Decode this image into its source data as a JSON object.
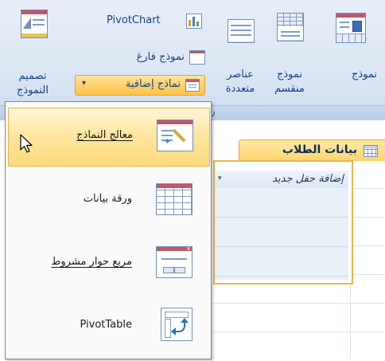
{
  "ribbon": {
    "pivotchart_label": "PivotChart",
    "blank_form_label": "نموذج فارغ",
    "more_forms_label": "نماذج إضافية",
    "more_forms_arrow": "▾",
    "form_design_label_1": "تصميم",
    "form_design_label_2": "النموذج",
    "multiple_items_label_1": "عناصر",
    "multiple_items_label_2": "متعددة",
    "split_form_label_1": "نموذج",
    "split_form_label_2": "منقسم",
    "form_label": "نموذج",
    "group_fragment": "ن"
  },
  "document": {
    "tab_title": "بيانات الطلاب",
    "add_field_header": "إضافة حقل جديد",
    "header_dropdown": "▾"
  },
  "menu": {
    "items": [
      {
        "label": "معالج النماذج",
        "icon": "form-wizard-icon",
        "state": "hover"
      },
      {
        "label": "ورقة بيانات",
        "icon": "datasheet-icon"
      },
      {
        "label": "مربع حوار مشروط",
        "icon": "modal-dialog-icon"
      },
      {
        "label": "PivotTable",
        "icon": "pivottable-icon"
      }
    ]
  },
  "colors": {
    "ribbon_bg": "#dbe6f4",
    "highlight": "#ffd97a",
    "form_accent": "#c2566a",
    "border_blue": "#6f8fbd",
    "tab_orange": "#f0b44a"
  }
}
